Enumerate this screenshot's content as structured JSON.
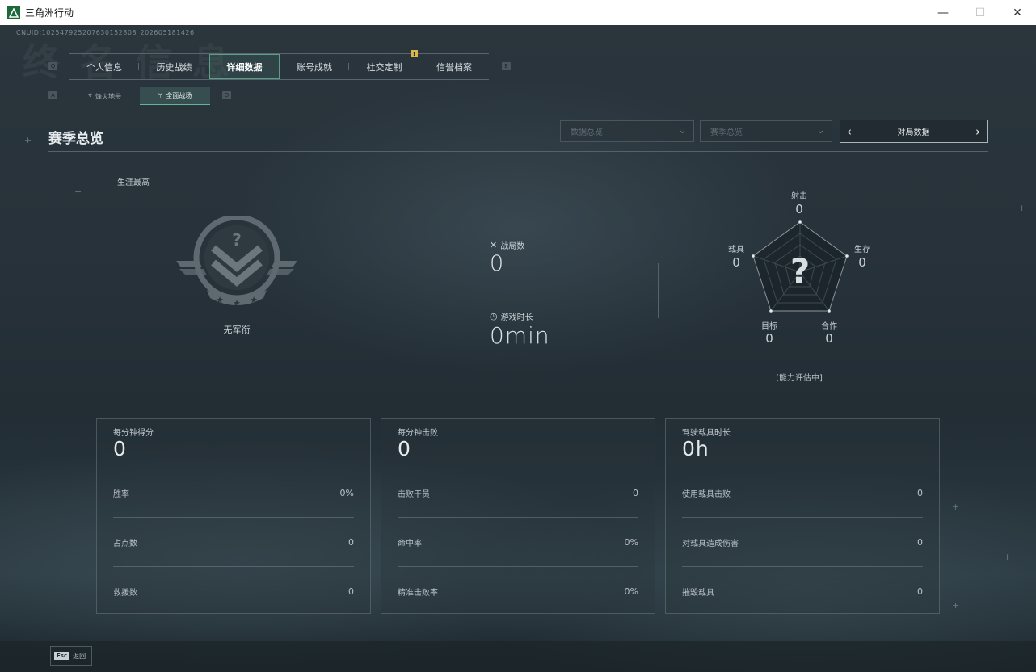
{
  "window": {
    "title": "三角洲行动",
    "controls": {
      "minimize": "—",
      "maximize": "☐",
      "close": "✕"
    }
  },
  "header": {
    "uid": "CNUID:10254792520763015280​8_202605181426",
    "hotkeys": {
      "prev_tab": "Q",
      "next_tab": "E",
      "prev_sub": "A",
      "next_sub": "D"
    }
  },
  "main_tabs": [
    {
      "label": "个人信息",
      "active": false
    },
    {
      "label": "历史战绩",
      "active": false
    },
    {
      "label": "详细数据",
      "active": true
    },
    {
      "label": "账号成就",
      "active": false
    },
    {
      "label": "社交定制",
      "active": false,
      "badge": "!"
    },
    {
      "label": "信誉档案",
      "active": false
    }
  ],
  "sub_tabs": [
    {
      "label": "烽火地带",
      "icon": "radar-icon",
      "active": false
    },
    {
      "label": "全面战场",
      "icon": "branch-icon",
      "active": true
    }
  ],
  "section": {
    "title": "赛季总览",
    "dropdown_1": "数据总览",
    "dropdown_2": "赛季总览",
    "cycler_label": "对局数据"
  },
  "career": {
    "label": "生涯最高",
    "rank_name": "无军衔",
    "matches_label": "战局数",
    "matches_value": "0",
    "playtime_label": "游戏时长",
    "playtime_value": "0min"
  },
  "radar": {
    "shooting": {
      "label": "射击",
      "value": "0"
    },
    "survival": {
      "label": "生存",
      "value": "0"
    },
    "cooperation": {
      "label": "合作",
      "value": "0"
    },
    "objective": {
      "label": "目标",
      "value": "0"
    },
    "vehicle": {
      "label": "载具",
      "value": "0"
    },
    "unknown_mark": "?",
    "status": "[能力评估中]"
  },
  "cards": [
    {
      "title": "每分钟得分",
      "big": "0",
      "rows": [
        {
          "key": "胜率",
          "value": "0%"
        },
        {
          "key": "占点数",
          "value": "0"
        },
        {
          "key": "救援数",
          "value": "0"
        }
      ]
    },
    {
      "title": "每分钟击败",
      "big": "0",
      "rows": [
        {
          "key": "击败干员",
          "value": "0"
        },
        {
          "key": "命中率",
          "value": "0%"
        },
        {
          "key": "精准击败率",
          "value": "0%"
        }
      ]
    },
    {
      "title": "驾驶载具时长",
      "big": "0h",
      "rows": [
        {
          "key": "使用载具击败",
          "value": "0"
        },
        {
          "key": "对载具造成伤害",
          "value": "0"
        },
        {
          "key": "摧毁载具",
          "value": "0"
        }
      ]
    }
  ],
  "footer": {
    "esc_key": "Esc",
    "esc_label": "返回"
  },
  "colors": {
    "accent": "#5fb69b",
    "badge": "#d8b84b",
    "background": "#27323a"
  }
}
